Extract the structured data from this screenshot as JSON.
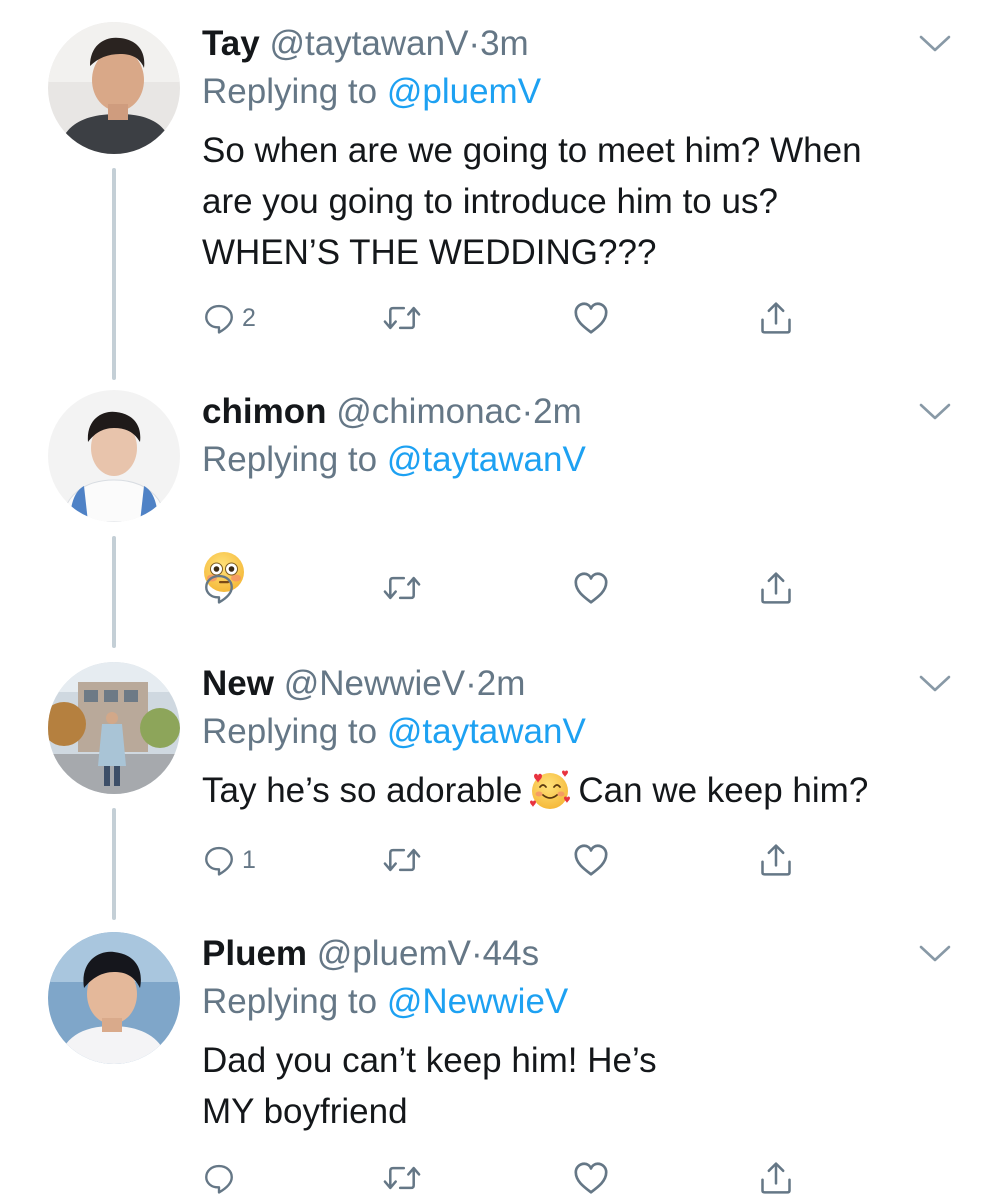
{
  "colors": {
    "text": "#14171a",
    "secondary": "#657786",
    "link": "#1da1f2",
    "thread_line": "#c4cfd6"
  },
  "tweets": [
    {
      "name": "Tay",
      "handle": "@taytawanV",
      "dot": "·",
      "time": "3m",
      "replying_prefix": "Replying to",
      "replying_to": "@pluemV",
      "text": "So when are we going to meet him? When\nare you going to introduce him to us?\nWHEN’S THE WEDDING???",
      "reply_count": "2",
      "avatar_icon": "avatar-photo-tay"
    },
    {
      "name": "chimon",
      "handle": "@chimonac",
      "dot": "·",
      "time": "2m",
      "replying_prefix": "Replying to",
      "replying_to": "@taytawanV",
      "emoji": "flushed-face-emoji",
      "avatar_icon": "avatar-photo-chimon"
    },
    {
      "name": "New",
      "handle": "@NewwieV",
      "dot": "·",
      "time": "2m",
      "replying_prefix": "Replying to",
      "replying_to": "@taytawanV",
      "text_before": "Tay he’s so adorable",
      "emoji": "smiling-face-with-hearts-emoji",
      "text_after": "Can we keep him?",
      "reply_count": "1",
      "avatar_icon": "avatar-photo-new"
    },
    {
      "name": "Pluem",
      "handle": "@pluemV",
      "dot": "·",
      "time": "44s",
      "replying_prefix": "Replying to",
      "replying_to": "@NewwieV",
      "text": "Dad you can’t keep him! He’s\nMY boyfriend",
      "avatar_icon": "avatar-photo-pluem"
    }
  ],
  "action_icons": [
    "reply-icon",
    "retweet-icon",
    "like-icon",
    "share-icon"
  ]
}
